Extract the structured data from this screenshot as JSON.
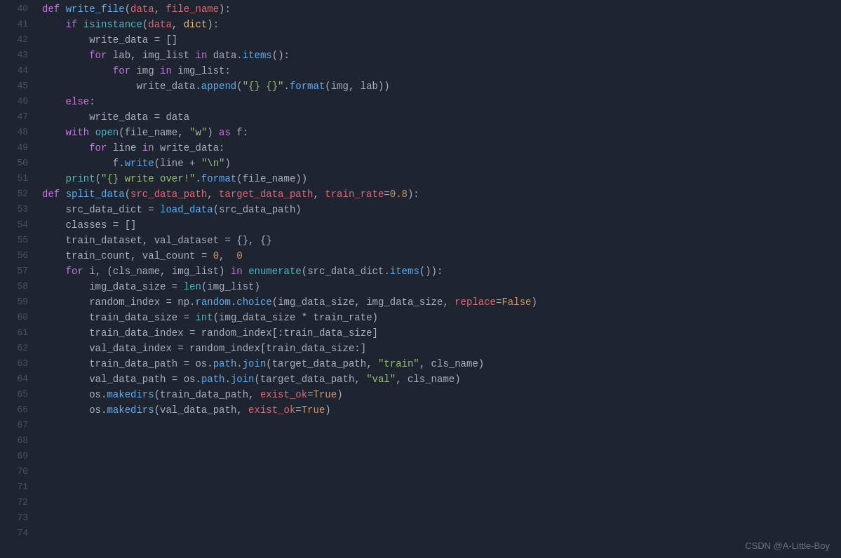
{
  "editor": {
    "background": "#1e2430",
    "watermark": "CSDN @A-Little-Boy"
  }
}
